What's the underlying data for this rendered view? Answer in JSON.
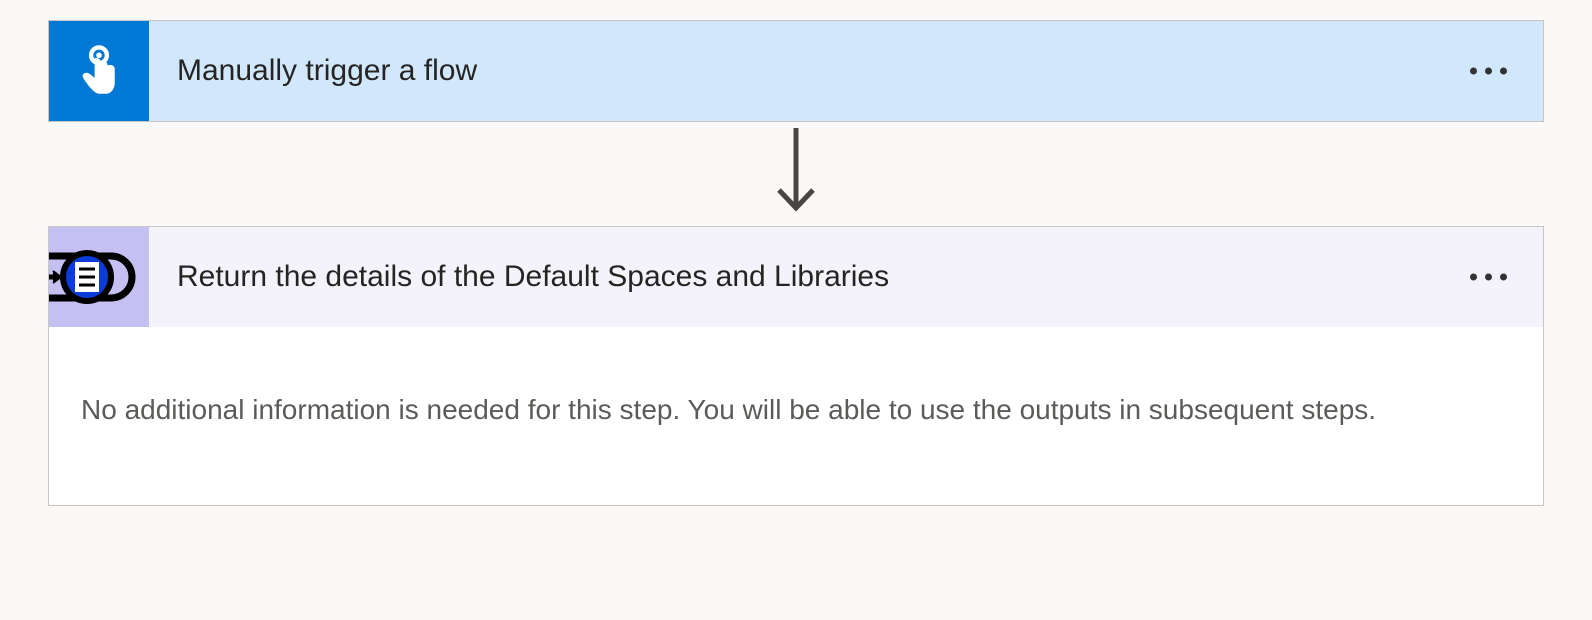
{
  "trigger": {
    "title": "Manually trigger a flow"
  },
  "action": {
    "title": "Return the details of the Default Spaces and Libraries",
    "body": "No additional information is needed for this step. You will be able to use the outputs in subsequent steps."
  }
}
